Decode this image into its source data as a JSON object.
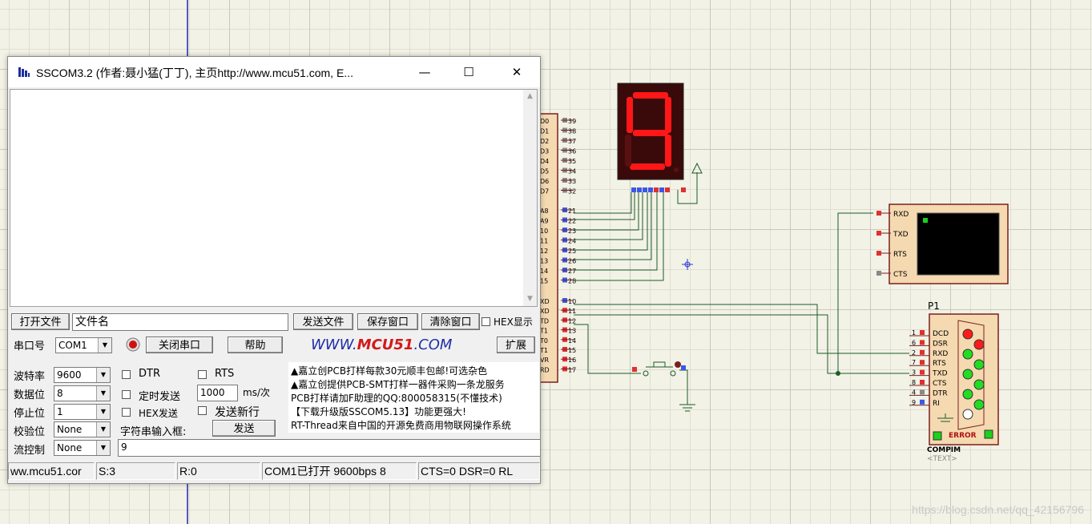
{
  "window": {
    "title": "SSCOM3.2 (作者:聂小猛(丁丁), 主页http://www.mcu51.com,  E...",
    "minimize_icon": "minimize-icon",
    "maximize_icon": "maximize-icon",
    "close_icon": "close-icon"
  },
  "toolbar": {
    "open_file": "打开文件",
    "file_name": "文件名",
    "send_file": "发送文件",
    "save_window": "保存窗口",
    "clear_window": "清除窗口",
    "hex_display": "HEX显示"
  },
  "port": {
    "label": "串口号",
    "value": "COM1",
    "close_port": "关闭串口",
    "help": "帮助",
    "expand": "扩展"
  },
  "logo": {
    "pre": "WWW.",
    "mid": "MCU51",
    "post": ".COM"
  },
  "settings": {
    "baud_label": "波特率",
    "baud_value": "9600",
    "data_label": "数据位",
    "data_value": "8",
    "stop_label": "停止位",
    "stop_value": "1",
    "parity_label": "校验位",
    "parity_value": "None",
    "flow_label": "流控制",
    "flow_value": "None"
  },
  "options": {
    "dtr": "DTR",
    "rts": "RTS",
    "timed_send": "定时发送",
    "interval_value": "1000",
    "interval_unit": "ms/次",
    "hex_send": "HEX发送",
    "send_newline": "发送新行",
    "input_label": "字符串输入框:",
    "send_button": "发送",
    "input_value": "9"
  },
  "ads": [
    "▲嘉立创PCB打样每款30元顺丰包邮!可选杂色",
    "▲嘉立创提供PCB-SMT打样一器件采购一条龙服务",
    "PCB打样请加F助理的QQ:800058315(不懂技术)",
    "【下载升级版SSCOM5.13】功能更强大!",
    "RT-Thread来自中国的开源免费商用物联网操作系统"
  ],
  "status": {
    "site": "ww.mcu51.cor",
    "sent": "S:3",
    "recv": "R:0",
    "port_state": "COM1已打开  9600bps  8",
    "lines": "CTS=0 DSR=0 RL"
  },
  "schematic": {
    "display_digit": "9",
    "mcu_pins_right": [
      "D0",
      "D1",
      "D2",
      "D3",
      "D4",
      "D5",
      "D6",
      "D7"
    ],
    "mcu_pin_numbers_top": [
      "39",
      "38",
      "37",
      "36",
      "35",
      "34",
      "33",
      "32"
    ],
    "mcu_pins_mid": [
      "A8",
      "A9",
      "10",
      "11",
      "12",
      "13",
      "14",
      "15"
    ],
    "mcu_pin_numbers_mid": [
      "21",
      "22",
      "23",
      "24",
      "25",
      "26",
      "27",
      "28"
    ],
    "mcu_pins_low": [
      "XD",
      "XD",
      "TD",
      "T1",
      "T0",
      "T1",
      "VR",
      "RD"
    ],
    "mcu_pin_numbers_low": [
      "10",
      "11",
      "12",
      "13",
      "14",
      "15",
      "16",
      "17"
    ],
    "terminal_pins": [
      "RXD",
      "TXD",
      "RTS",
      "CTS"
    ],
    "connector_name": "P1",
    "connector_pins": [
      "DCD",
      "DSR",
      "RXD",
      "RTS",
      "TXD",
      "CTS",
      "DTR",
      "RI"
    ],
    "connector_pin_numbers": [
      "1",
      "6",
      "2",
      "7",
      "3",
      "8",
      "4",
      "9"
    ],
    "connector_part": "COMPIM",
    "connector_text": "<TEXT>",
    "error_label": "ERROR"
  },
  "watermark": "https://blog.csdn.net/qq_42156796",
  "colors": {
    "accent_blue": "#1f2ea8",
    "accent_red": "#d21a1a",
    "wire": "#1d5b28",
    "led_on": "#ff1a1a"
  }
}
